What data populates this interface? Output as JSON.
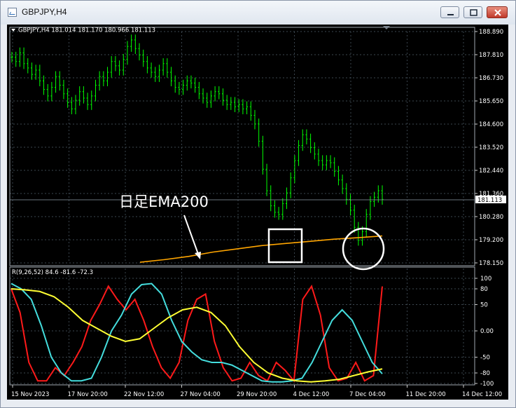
{
  "window": {
    "title": "GBPJPY,H4"
  },
  "chart_info": {
    "main_header": "GBPJPY,H4  181.014 181.170 180.966 181.113",
    "sub_header": "R(9,26,52) 84.6 -81.6 -72.3",
    "current_price": "181.113",
    "annotation": "日足EMA200"
  },
  "colors": {
    "candle": "#00ff00",
    "ema": "#ffa500",
    "red_line": "#ff1a1a",
    "cyan_line": "#44dddd",
    "yellow_line": "#ffff33",
    "grid": "#5a6b7a"
  },
  "chart_data": [
    {
      "type": "candlestick",
      "symbol": "GBPJPY",
      "timeframe": "H4",
      "ylim": [
        178.15,
        188.89
      ],
      "y_ticks": [
        "188.890",
        "187.810",
        "186.730",
        "185.650",
        "184.600",
        "183.520",
        "182.440",
        "181.360",
        "180.280",
        "179.200",
        "178.150"
      ],
      "x_ticks": [
        "15 Nov 2023",
        "17 Nov 20:00",
        "22 Nov 12:00",
        "27 Nov 04:00",
        "29 Nov 20:00",
        "4 Dec 12:00",
        "7 Dec 04:00",
        "11 Dec 20:00",
        "14 Dec 12:00"
      ],
      "close_series": [
        187.7,
        187.5,
        187.9,
        187.4,
        187.2,
        186.9,
        187.1,
        186.6,
        186.2,
        185.9,
        186.3,
        186.8,
        186.4,
        186.0,
        185.6,
        185.3,
        185.7,
        186.1,
        185.8,
        185.5,
        185.9,
        186.4,
        186.8,
        186.6,
        187.0,
        187.5,
        187.3,
        187.1,
        187.6,
        188.2,
        188.5,
        188.1,
        187.8,
        187.5,
        187.2,
        187.0,
        186.8,
        187.1,
        187.4,
        187.0,
        186.6,
        186.3,
        186.2,
        186.4,
        186.6,
        186.5,
        186.3,
        186.0,
        185.8,
        185.6,
        185.9,
        186.1,
        186.0,
        185.7,
        185.5,
        185.6,
        185.4,
        185.5,
        185.3,
        185.4,
        185.0,
        184.6,
        183.8,
        182.5,
        181.5,
        180.8,
        180.5,
        180.4,
        180.9,
        181.4,
        182.1,
        182.9,
        183.6,
        184.1,
        183.9,
        183.5,
        183.2,
        182.9,
        182.7,
        182.9,
        182.8,
        182.4,
        182.0,
        181.6,
        181.1,
        180.6,
        179.8,
        179.2,
        179.6,
        180.4,
        181.0,
        181.2,
        181.5,
        181.1
      ],
      "ema200": [
        178.18,
        178.3,
        178.45,
        178.65,
        178.8,
        178.95,
        179.05,
        179.15,
        179.25,
        179.32,
        179.4
      ],
      "annotation": "日足EMA200"
    },
    {
      "type": "line",
      "title": "R(9,26,52) 84.6 -81.6 -72.3",
      "ylim": [
        -100,
        100
      ],
      "y_ticks": [
        "100",
        "80",
        "50",
        "0.00",
        "-50",
        "-80",
        "-100"
      ],
      "series": [
        {
          "color": "#ff1a1a",
          "values": [
            80,
            35,
            -60,
            -95,
            -95,
            -70,
            -85,
            -60,
            -30,
            20,
            50,
            85,
            60,
            40,
            60,
            20,
            -30,
            -70,
            -90,
            -60,
            20,
            60,
            70,
            -20,
            -70,
            -95,
            -90,
            -60,
            -85,
            -95,
            -60,
            -75,
            -95,
            60,
            85,
            30,
            -70,
            -95,
            -90,
            -60,
            -95,
            -85,
            84.6
          ]
        },
        {
          "color": "#44dddd",
          "values": [
            90,
            80,
            60,
            10,
            -50,
            -80,
            -95,
            -95,
            -90,
            -50,
            0,
            30,
            70,
            88,
            90,
            70,
            20,
            -20,
            -40,
            -55,
            -60,
            -60,
            -65,
            -75,
            -85,
            -95,
            -97,
            -97,
            -95,
            -90,
            -60,
            -20,
            20,
            40,
            20,
            -20,
            -60,
            -81.6
          ]
        },
        {
          "color": "#ffff33",
          "values": [
            80,
            78,
            75,
            65,
            45,
            20,
            5,
            -10,
            -20,
            -15,
            5,
            25,
            40,
            45,
            35,
            10,
            -30,
            -60,
            -80,
            -90,
            -95,
            -97,
            -95,
            -92,
            -85,
            -78,
            -72.3
          ]
        }
      ]
    }
  ]
}
